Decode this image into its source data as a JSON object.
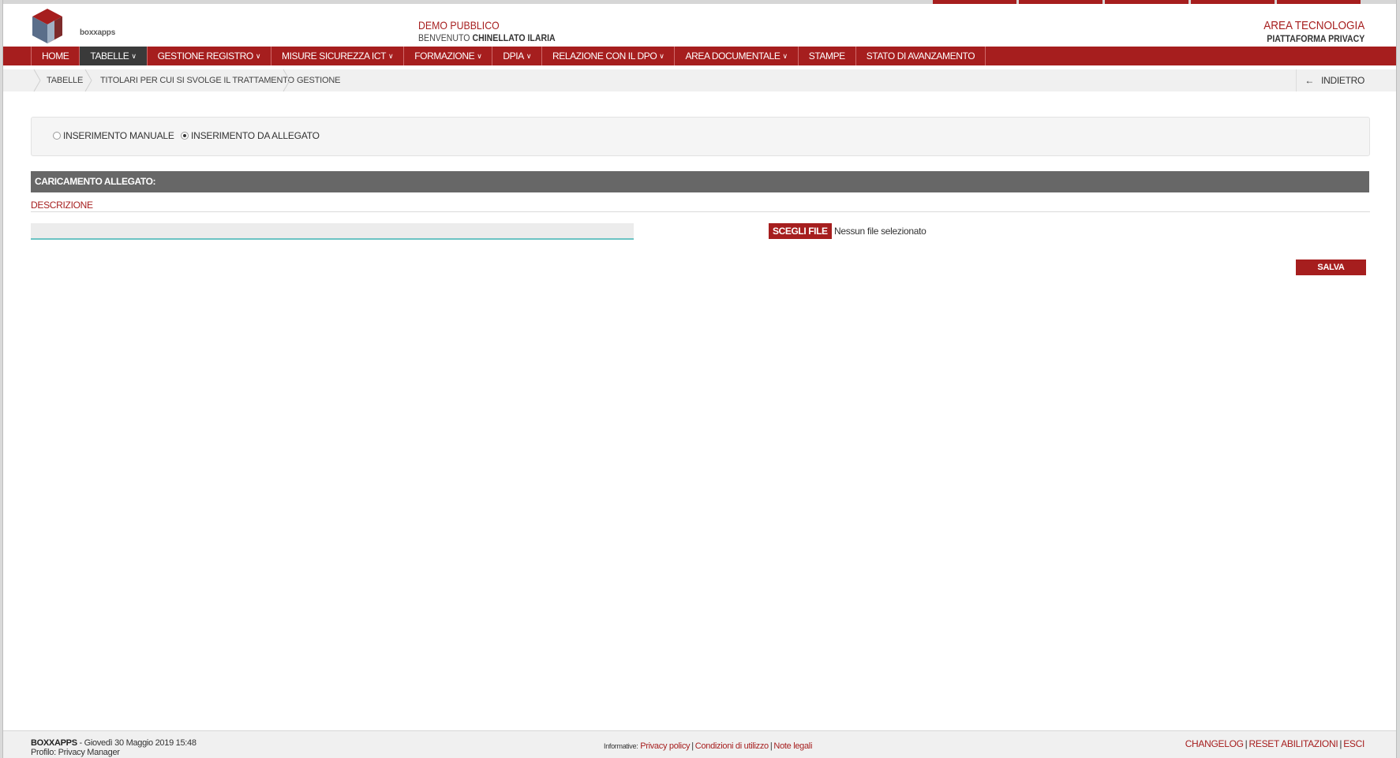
{
  "colors": {
    "brand_red": "#a61e1e",
    "nav_active": "#3a3a3a",
    "section_bar": "#676767",
    "input_underline": "#6cc3c3"
  },
  "logo": {
    "text": "boxxapps"
  },
  "header": {
    "demo": "DEMO PUBBLICO",
    "welcome_prefix": "BENVENUTO",
    "user_name": "CHINELLATO ILARIA",
    "area": "AREA TECNOLOGIA",
    "platform": "PIATTAFORMA PRIVACY"
  },
  "nav": {
    "items": [
      {
        "label": "HOME",
        "dropdown": false,
        "active": false
      },
      {
        "label": "TABELLE",
        "dropdown": true,
        "active": true
      },
      {
        "label": "GESTIONE REGISTRO",
        "dropdown": true,
        "active": false
      },
      {
        "label": "MISURE SICUREZZA ICT",
        "dropdown": true,
        "active": false
      },
      {
        "label": "FORMAZIONE",
        "dropdown": true,
        "active": false
      },
      {
        "label": "DPIA",
        "dropdown": true,
        "active": false
      },
      {
        "label": "RELAZIONE CON IL DPO",
        "dropdown": true,
        "active": false
      },
      {
        "label": "AREA DOCUMENTALE",
        "dropdown": true,
        "active": false
      },
      {
        "label": "STAMPE",
        "dropdown": false,
        "active": false
      },
      {
        "label": "STATO DI AVANZAMENTO",
        "dropdown": false,
        "active": false
      }
    ]
  },
  "breadcrumb": {
    "items": [
      "TABELLE",
      "TITOLARI PER CUI SI SVOLGE IL TRATTAMENTO",
      "GESTIONE"
    ],
    "back_label": "INDIETRO",
    "back_icon": "arrow-left-icon"
  },
  "form": {
    "radio_manual": "INSERIMENTO MANUALE",
    "radio_attachment": "INSERIMENTO DA ALLEGATO",
    "selected": "attachment",
    "section_title": "CARICAMENTO ALLEGATO:",
    "description_label": "DESCRIZIONE",
    "description_value": "",
    "file_button": "SCEGLI FILE",
    "file_status": "Nessun file selezionato",
    "save_button": "SALVA"
  },
  "footer": {
    "brand": "BOXXAPPS",
    "datetime": "- Giovedì 30 Maggio 2019 15:48",
    "profile": "Profilo: Privacy Manager",
    "informative_label": "Informative:",
    "links_center": [
      "Privacy policy",
      "Condizioni di utilizzo",
      "Note legali"
    ],
    "links_right": [
      "CHANGELOG",
      "RESET ABILITAZIONI",
      "ESCI"
    ]
  }
}
